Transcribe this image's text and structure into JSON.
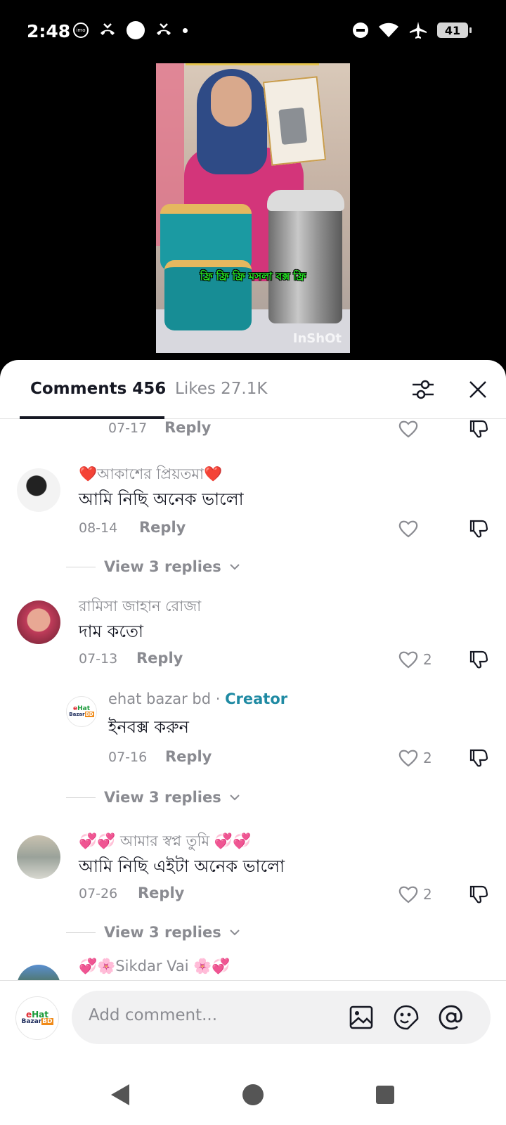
{
  "status_bar": {
    "time": "2:48",
    "battery": "41",
    "imo_label": "imo"
  },
  "video": {
    "caption": "ফ্রি ফ্রি ফ্রি মসলা বক্স ফ্রি",
    "watermark": "InShOt"
  },
  "tabs": {
    "comments_label": "Comments 456",
    "likes_label": "Likes 27.1K"
  },
  "comments_partial_top": {
    "date": "07-17",
    "reply": "Reply"
  },
  "comments": [
    {
      "name": "❤️আকাশের প্রিয়তমা❤️",
      "text": "আমি নিছি অনেক ভালো",
      "date": "08-14",
      "reply": "Reply",
      "likes": "",
      "view_replies": "View 3 replies"
    },
    {
      "name": "রামিসা জাহান রোজা",
      "text": "দাম কতো",
      "date": "07-13",
      "reply": "Reply",
      "likes": "2",
      "reply_item": {
        "name": "ehat bazar bd",
        "separator": " · ",
        "badge": "Creator",
        "text": "ইনবক্স করুন",
        "date": "07-16",
        "reply": "Reply",
        "likes": "2"
      },
      "view_replies": "View 3 replies"
    },
    {
      "name": "💞💞 আমার স্বপ্ন তুমি 💞💞",
      "text": "আমি নিছি এইটা অনেক ভালো",
      "date": "07-26",
      "reply": "Reply",
      "likes": "2",
      "view_replies": "View 3 replies"
    },
    {
      "name": "💞🌸Sikdar Vai 🌸💞"
    }
  ],
  "input": {
    "placeholder": "Add comment...",
    "logo_top_e": "e",
    "logo_top_hat": "Hat",
    "logo_bottom_bazar": "Bazar",
    "logo_bottom_bd": "BD"
  },
  "colors": {
    "accent_creator": "#1f8aa3",
    "text_primary": "#161823",
    "text_secondary": "#8a8b91"
  }
}
